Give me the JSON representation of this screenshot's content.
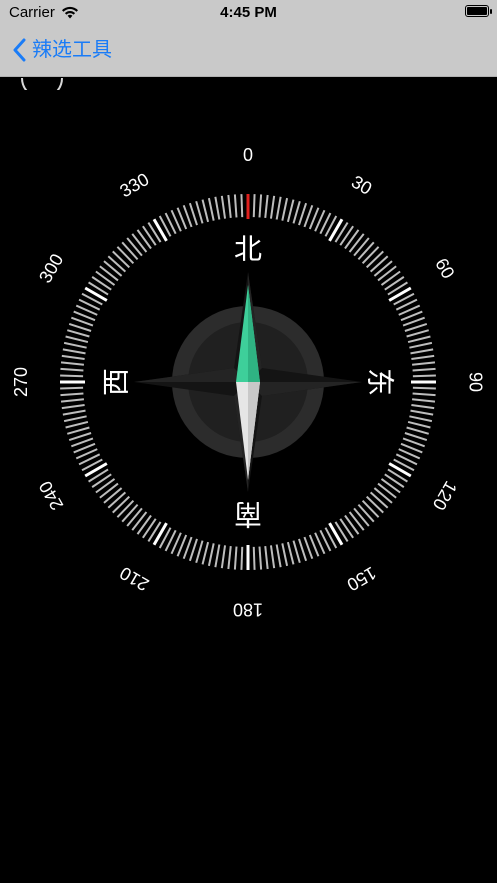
{
  "status": {
    "carrier": "Carrier",
    "time": "4:45 PM"
  },
  "nav": {
    "back_label": "辣选工具"
  },
  "compass": {
    "degree_labels": [
      "0",
      "30",
      "60",
      "90",
      "120",
      "150",
      "180",
      "210",
      "240",
      "270",
      "300",
      "330"
    ],
    "cardinals": {
      "north": "北",
      "east": "东",
      "south": "南",
      "west": "西"
    },
    "heading_degrees": 0,
    "colors": {
      "north_needle": "#3ecf9a",
      "south_needle": "#e6e6e6",
      "heading_marker": "#e0201d",
      "tick": "#bdbdbd"
    }
  },
  "icons": {
    "back": "chevron-left-icon",
    "wifi": "wifi-icon",
    "battery": "battery-icon"
  }
}
